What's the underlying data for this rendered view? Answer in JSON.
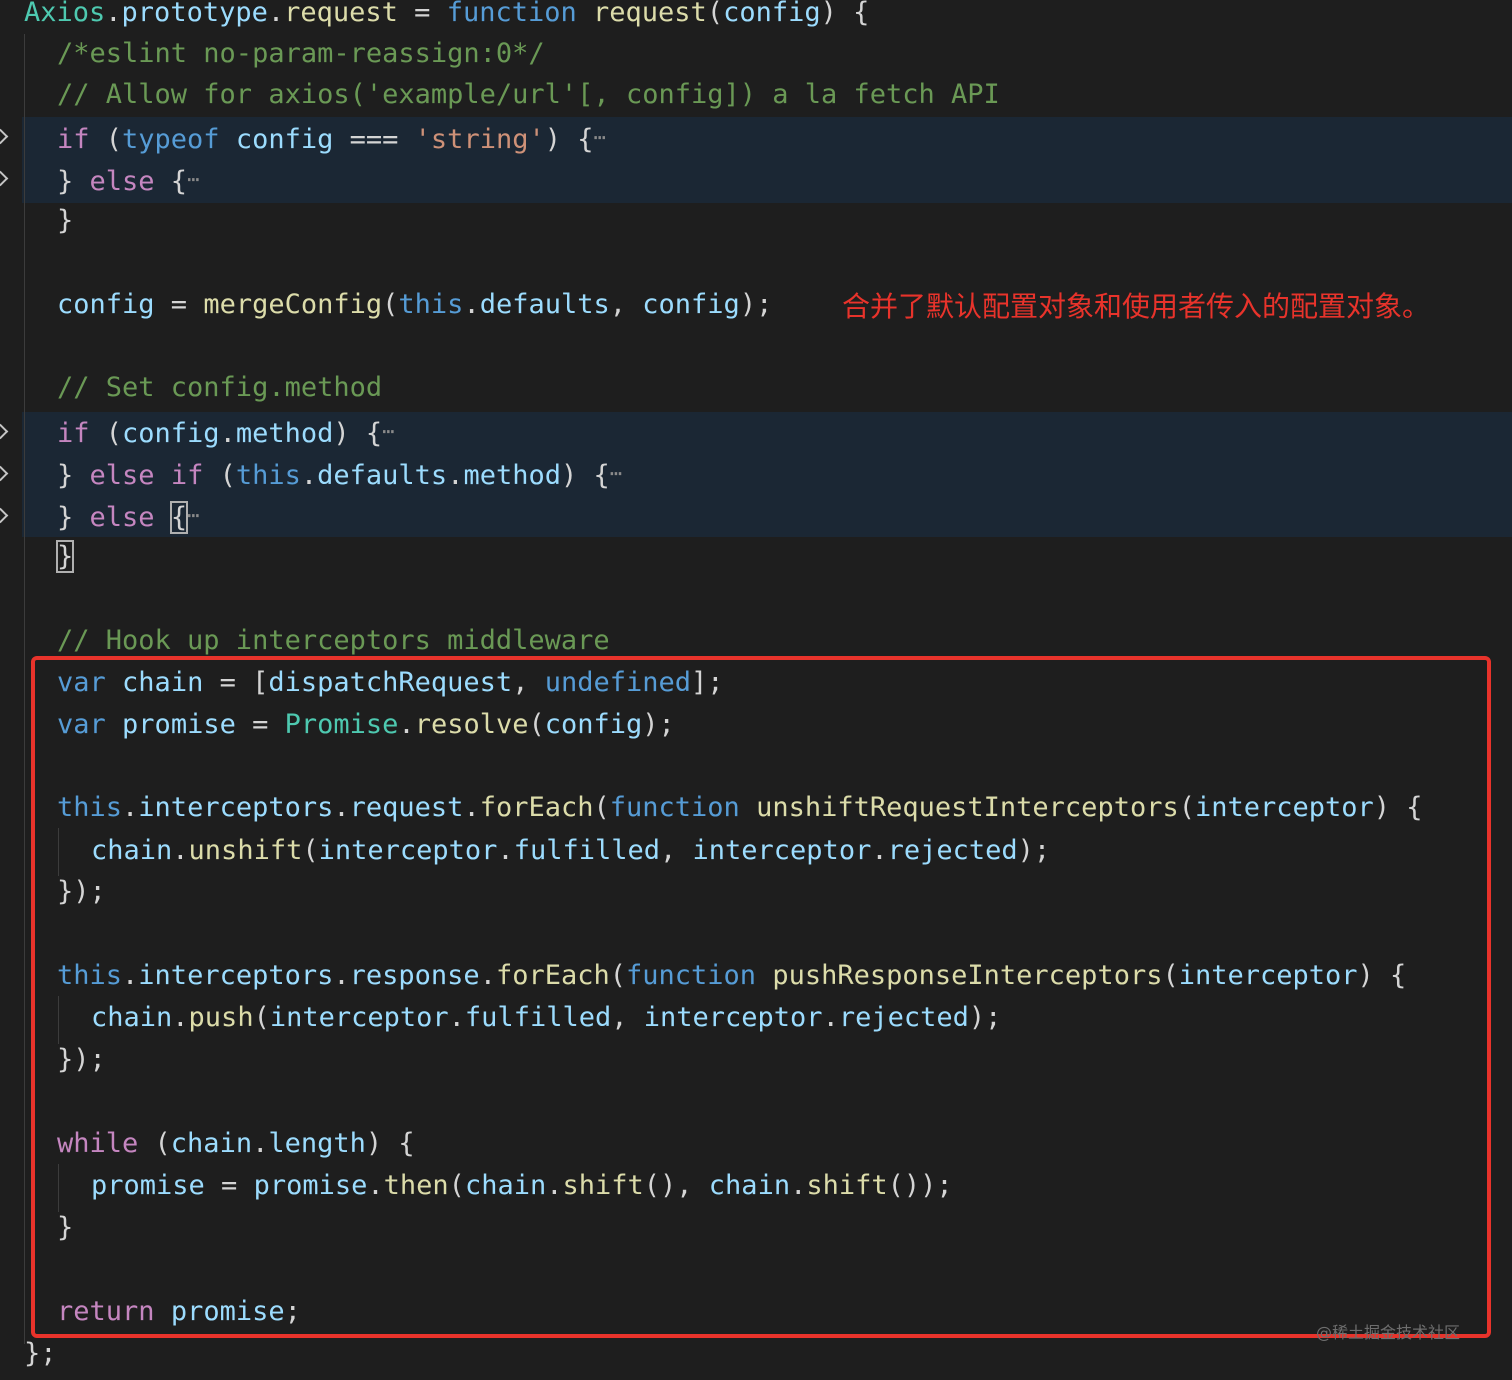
{
  "editor": {
    "theme_colors": {
      "background": "#1e1e1e",
      "keyword_control": "#c586c0",
      "keyword_storage": "#569cd6",
      "variable": "#9cdcfe",
      "function": "#dcdcaa",
      "string": "#ce9178",
      "comment": "#6a9955",
      "type": "#4ec9b0",
      "annotation_red": "#e8332b"
    },
    "fold_placeholder": "⋯",
    "fold_icon": "chevron-right-icon",
    "lines": {
      "l1": [
        "Axios",
        ".",
        "prototype",
        ".",
        "request",
        " = ",
        "function",
        " ",
        "request",
        "(",
        "config",
        ") {"
      ],
      "l2": [
        "/*eslint no-param-reassign:0*/"
      ],
      "l3": [
        "// Allow for axios('example/url'[, config]) a la fetch API"
      ],
      "l4": [
        "if",
        " (",
        "typeof",
        " ",
        "config",
        " === ",
        "'string'",
        ") {"
      ],
      "l5": [
        "} ",
        "else",
        " {"
      ],
      "l6": [
        "}"
      ],
      "l7": [
        "config",
        " = ",
        "mergeConfig",
        "(",
        "this",
        ".",
        "defaults",
        ", ",
        "config",
        ");"
      ],
      "l8": [
        "// Set config.method"
      ],
      "l9": [
        "if",
        " (",
        "config",
        ".",
        "method",
        ") {"
      ],
      "l10": [
        "} ",
        "else",
        " ",
        "if",
        " (",
        "this",
        ".",
        "defaults",
        ".",
        "method",
        ") {"
      ],
      "l11": [
        "} ",
        "else",
        " ",
        "{"
      ],
      "l12": [
        "}"
      ],
      "l13": [
        "// Hook up interceptors middleware"
      ],
      "l14": [
        "var",
        " ",
        "chain",
        " = [",
        "dispatchRequest",
        ", ",
        "undefined",
        "];"
      ],
      "l15": [
        "var",
        " ",
        "promise",
        " = ",
        "Promise",
        ".",
        "resolve",
        "(",
        "config",
        ");"
      ],
      "l16": [
        "this",
        ".",
        "interceptors",
        ".",
        "request",
        ".",
        "forEach",
        "(",
        "function",
        " ",
        "unshiftRequestInterceptors",
        "(",
        "interceptor",
        ") {"
      ],
      "l17": [
        "chain",
        ".",
        "unshift",
        "(",
        "interceptor",
        ".",
        "fulfilled",
        ", ",
        "interceptor",
        ".",
        "rejected",
        ");"
      ],
      "l18": [
        "});"
      ],
      "l19": [
        "this",
        ".",
        "interceptors",
        ".",
        "response",
        ".",
        "forEach",
        "(",
        "function",
        " ",
        "pushResponseInterceptors",
        "(",
        "interceptor",
        ") {"
      ],
      "l20": [
        "chain",
        ".",
        "push",
        "(",
        "interceptor",
        ".",
        "fulfilled",
        ", ",
        "interceptor",
        ".",
        "rejected",
        ");"
      ],
      "l21": [
        "});"
      ],
      "l22": [
        "while",
        " (",
        "chain",
        ".",
        "length",
        ") {"
      ],
      "l23": [
        "promise",
        " = ",
        "promise",
        ".",
        "then",
        "(",
        "chain",
        ".",
        "shift",
        "(), ",
        "chain",
        ".",
        "shift",
        "());"
      ],
      "l24": [
        "}"
      ],
      "l25": [
        "return",
        " ",
        "promise",
        ";"
      ],
      "l26": [
        "};"
      ]
    }
  },
  "annotation": {
    "text": "合并了默认配置对象和使用者传入的配置对象。",
    "color": "#e8332b"
  },
  "watermark": "@稀土掘金技术社区"
}
